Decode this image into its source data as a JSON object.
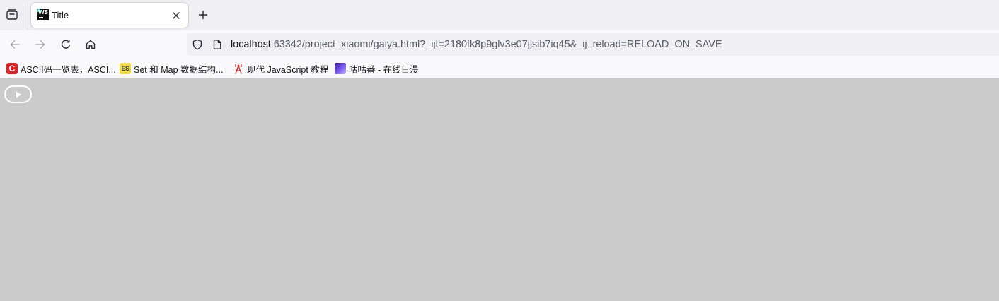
{
  "browser": {
    "tab": {
      "title": "Title",
      "favicon": "webstorm-icon"
    },
    "icons": {
      "tab_overview": "tab-overview-icon",
      "close": "close-icon",
      "new_tab": "plus-icon",
      "back": "back-arrow-icon",
      "forward": "forward-arrow-icon",
      "reload": "reload-icon",
      "home": "home-icon",
      "shield": "shield-icon",
      "page": "page-icon"
    },
    "url": {
      "host": "localhost",
      "rest": ":63342/project_xiaomi/gaiya.html?_ijt=2180fk8p9glv3e07jjsib7iq45&_ij_reload=RELOAD_ON_SAVE"
    },
    "bookmarks": [
      {
        "label": "ASCII码一览表，ASCI...",
        "icon": "c-red-icon",
        "icon_text": "C"
      },
      {
        "label": "Set 和 Map 数据结构...",
        "icon": "es-icon",
        "icon_text": "ES"
      },
      {
        "label": "现代 JavaScript 教程",
        "icon": "radio-tower-icon"
      },
      {
        "label": "咕咕番 - 在线日漫",
        "icon": "gugufan-icon"
      }
    ]
  },
  "page": {
    "background": "#cbcbcb",
    "play_control": "play-icon"
  }
}
